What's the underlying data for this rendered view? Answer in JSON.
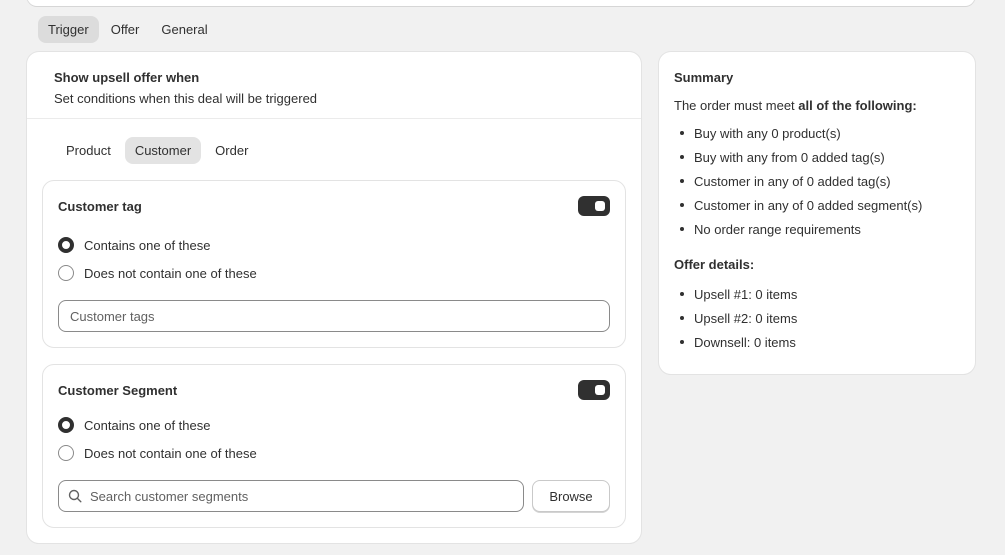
{
  "main_tabs": [
    "Trigger",
    "Offer",
    "General"
  ],
  "left_card": {
    "title": "Show upsell offer when",
    "subtitle": "Set conditions when this deal will be triggered",
    "sub_tabs": [
      "Product",
      "Customer",
      "Order"
    ]
  },
  "customer_tag": {
    "title": "Customer tag",
    "toggle_on": true,
    "option_contains": "Contains one of these",
    "option_not_contains": "Does not contain one of these",
    "selected": "contains",
    "input_placeholder": "Customer tags"
  },
  "customer_segment": {
    "title": "Customer Segment",
    "toggle_on": true,
    "option_contains": "Contains one of these",
    "option_not_contains": "Does not contain one of these",
    "selected": "contains",
    "search_placeholder": "Search customer segments",
    "browse_label": "Browse"
  },
  "summary": {
    "title": "Summary",
    "intro_prefix": "The order must meet ",
    "intro_bold": "all of the following:",
    "items": [
      "Buy with any 0 product(s)",
      "Buy with any from 0 added tag(s)",
      "Customer in any of 0 added tag(s)",
      "Customer in any of 0 added segment(s)",
      "No order range requirements"
    ],
    "offer_title": "Offer details:",
    "offer_items": [
      "Upsell #1: 0 items",
      "Upsell #2: 0 items",
      "Downsell: 0 items"
    ]
  }
}
